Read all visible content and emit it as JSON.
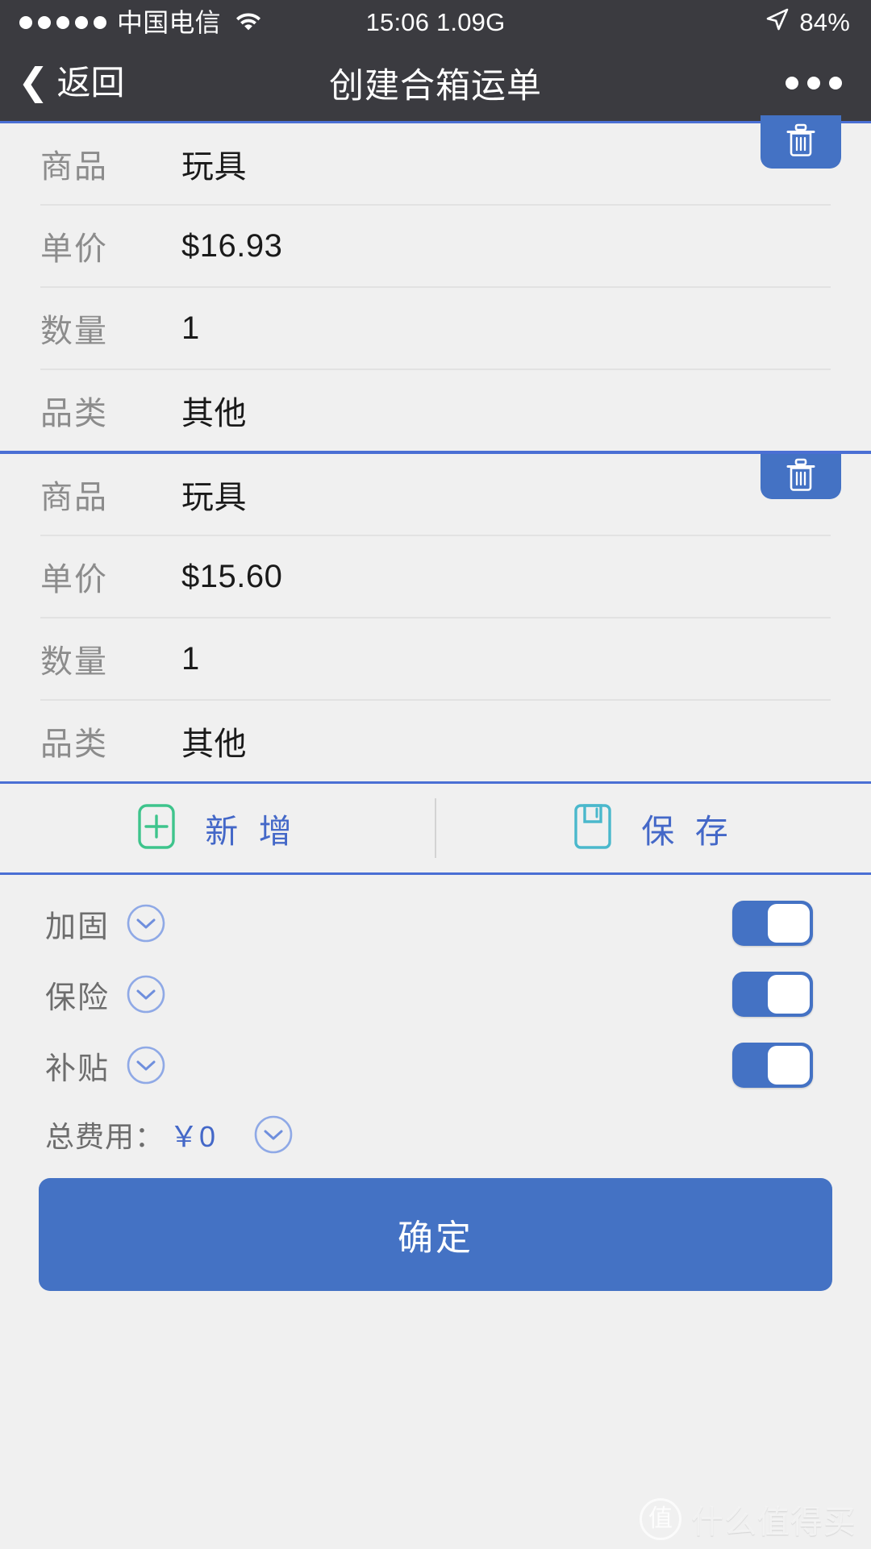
{
  "status_bar": {
    "signal_dots": 5,
    "carrier": "中国电信",
    "wifi_icon": "wifi-icon",
    "time_and_data": "15:06 1.09G",
    "location_icon": "location-arrow-icon",
    "battery": "84%"
  },
  "nav_bar": {
    "back_label": "返回",
    "back_icon": "chevron-left-icon",
    "title": "创建合箱运单",
    "more_icon": "more-horizontal-icon"
  },
  "items": [
    {
      "delete_icon": "trash-icon",
      "fields": [
        {
          "label": "商品",
          "value": "玩具"
        },
        {
          "label": "单价",
          "value": "$16.93"
        },
        {
          "label": "数量",
          "value": "1"
        },
        {
          "label": "品类",
          "value": "其他"
        }
      ]
    },
    {
      "delete_icon": "trash-icon",
      "fields": [
        {
          "label": "商品",
          "value": "玩具"
        },
        {
          "label": "单价",
          "value": "$15.60"
        },
        {
          "label": "数量",
          "value": "1"
        },
        {
          "label": "品类",
          "value": "其他"
        }
      ]
    }
  ],
  "action_bar": {
    "add": {
      "label": "新 增",
      "icon": "plus-box-icon",
      "icon_color": "#3ec48c"
    },
    "save": {
      "label": "保 存",
      "icon": "floppy-disk-icon",
      "icon_color": "#4ab8cc"
    },
    "label_color": "#4468c8"
  },
  "options": [
    {
      "label": "加固",
      "chevron_icon": "chevron-down-circle-icon",
      "toggle": "on"
    },
    {
      "label": "保险",
      "chevron_icon": "chevron-down-circle-icon",
      "toggle": "on"
    },
    {
      "label": "补贴",
      "chevron_icon": "chevron-down-circle-icon",
      "toggle": "on"
    }
  ],
  "total": {
    "label": "总费用：",
    "value": "￥0",
    "chevron_icon": "chevron-down-circle-icon"
  },
  "confirm": {
    "label": "确定"
  },
  "watermark": {
    "logo_text": "值",
    "text": "什么值得买"
  },
  "colors": {
    "accent_blue": "#4472c4",
    "link_blue": "#4468c8",
    "separator_blue": "#4a6fd4",
    "nav_bg": "#3b3b40",
    "page_bg": "#f0f0f0",
    "label_gray": "#8c8c8c"
  }
}
